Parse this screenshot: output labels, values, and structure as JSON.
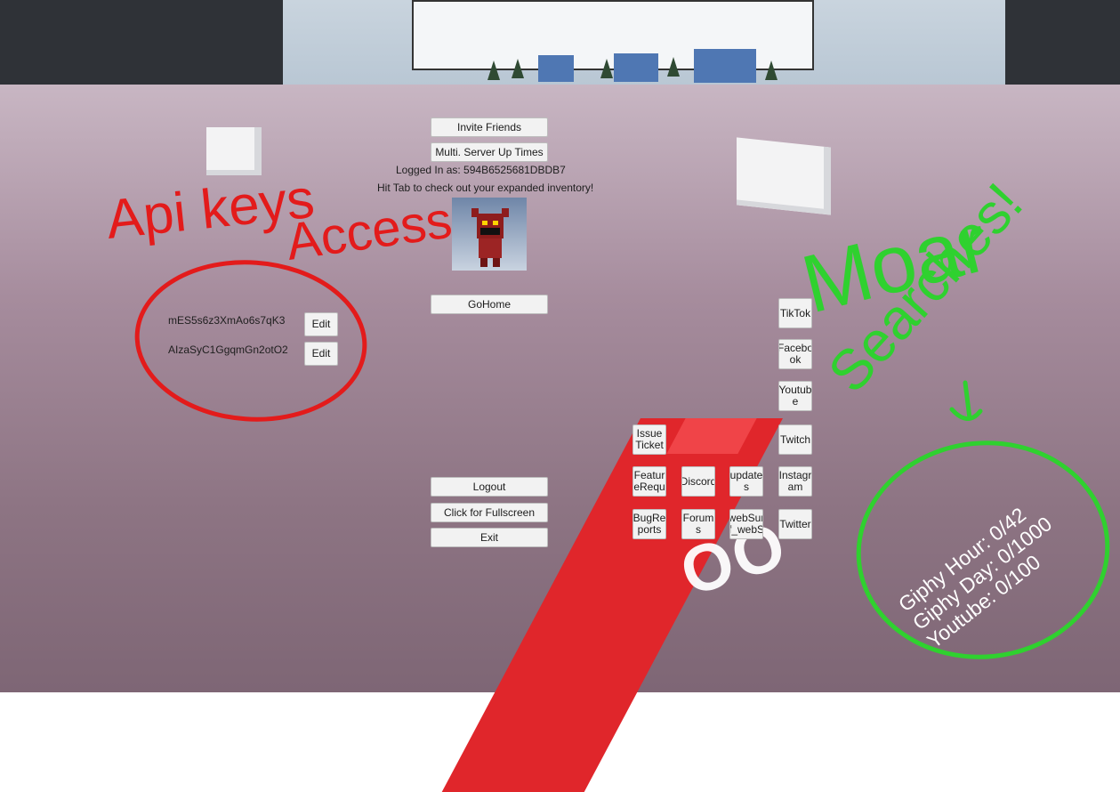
{
  "menu": {
    "invite_friends": "Invite Friends",
    "server_uptimes": "Multi. Server Up Times",
    "logged_in": "Logged In as: 594B6525681DBDB7",
    "hint": "Hit Tab to check out your expanded inventory!",
    "go_home": "GoHome",
    "logout": "Logout",
    "fullscreen": "Click for Fullscreen",
    "exit": "Exit"
  },
  "api_keys": [
    {
      "key": "mES5s6z3XmAo6s7qK3",
      "edit_label": "Edit"
    },
    {
      "key": "AIzaSyC1GgqmGn2otO2",
      "edit_label": "Edit"
    }
  ],
  "social": {
    "tiktok": "TikTok",
    "facebook": "Facebo ok",
    "youtube": "Youtub e",
    "twitch": "Twitch",
    "instagram": "Instagr am",
    "twitter": "Twitter"
  },
  "links": {
    "issue_ticket": "Issue Ticket",
    "feature_request": "Featur eRequ",
    "discord": "Discord",
    "updates": "update s",
    "bug_reports": "BugRe ports",
    "forums": "Forum s",
    "websurf": "webSur f_webS"
  },
  "stats": {
    "giphy_hour": "Giphy Hour: 0/42",
    "giphy_day": "Giphy Day: 0/1000",
    "youtube": "Youtube: 0/100"
  },
  "annotations": {
    "api_keys_title": "Api keys",
    "api_keys_sub": "Access",
    "moar": "Moar",
    "searches": "Searches!",
    "red_color": "#e31b1b",
    "green_color": "#2fd12f"
  },
  "world_text": {
    "oo": "OO"
  }
}
